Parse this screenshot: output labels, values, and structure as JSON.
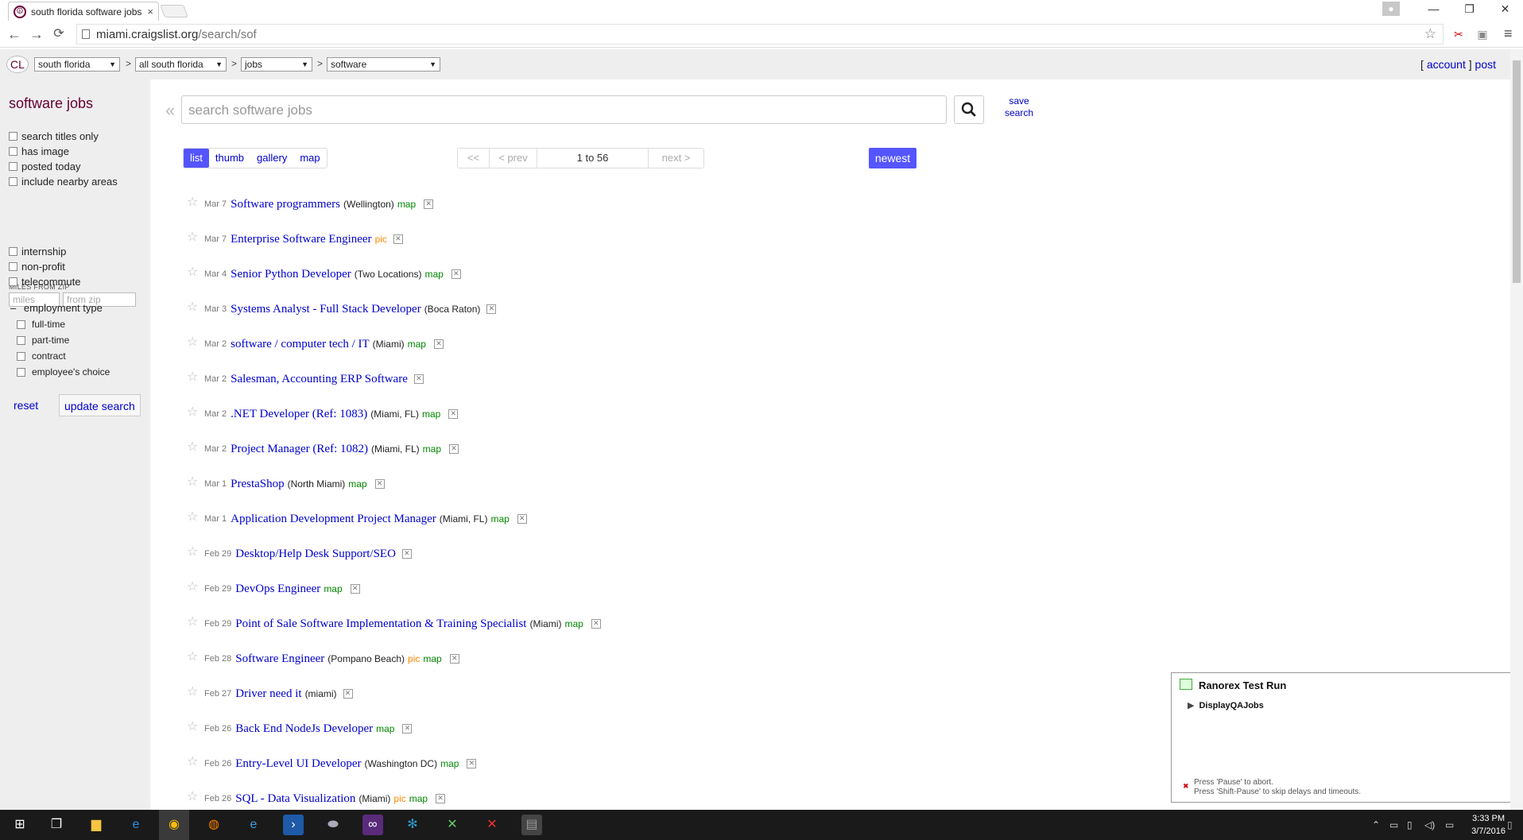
{
  "browser": {
    "tab_title": "south florida software jobs",
    "tab_close": "×",
    "url_host": "miami.craigslist.org",
    "url_path": "/search/sof",
    "back": "←",
    "forward": "→",
    "reload": "⟳",
    "bookmark_star": "☆",
    "menu": "≡"
  },
  "window_buttons": {
    "minimize": "—",
    "restore": "❐",
    "close": "✕"
  },
  "header": {
    "logo": "CL",
    "area": "south florida",
    "subarea": "all south florida",
    "category": "jobs",
    "subcategory": "software",
    "sep": ">",
    "account_open": "[",
    "account": "account",
    "account_close": "]",
    "post": "post"
  },
  "sidebar": {
    "title": "software jobs",
    "filters": [
      "search titles only",
      "has image",
      "posted today",
      "include nearby areas"
    ],
    "miles_label": "MILES FROM ZIP",
    "miles_placeholder": "miles",
    "zip_placeholder": "from zip",
    "flags": [
      "internship",
      "non-profit",
      "telecommute"
    ],
    "employment_toggle": "–",
    "employment_label": "employment type",
    "employment_types": [
      "full-time",
      "part-time",
      "contract",
      "employee's choice"
    ],
    "reset": "reset",
    "update": "update search"
  },
  "search": {
    "collapse": "«",
    "placeholder": "search software jobs",
    "save_line1": "save",
    "save_line2": "search"
  },
  "view_tabs": [
    "list",
    "thumb",
    "gallery",
    "map"
  ],
  "pager": {
    "first": "<<",
    "prev": "< prev",
    "range": "1 to 56",
    "next": "next >"
  },
  "sort": "newest",
  "listings": [
    {
      "date": "Mar 7",
      "title": "Software programmers",
      "hood": "(Wellington)",
      "pic": "",
      "map": "map"
    },
    {
      "date": "Mar 7",
      "title": "Enterprise Software Engineer",
      "hood": "",
      "pic": "pic",
      "map": ""
    },
    {
      "date": "Mar 4",
      "title": "Senior Python Developer",
      "hood": "(Two Locations)",
      "pic": "",
      "map": "map"
    },
    {
      "date": "Mar 3",
      "title": "Systems Analyst - Full Stack Developer",
      "hood": "(Boca Raton)",
      "pic": "",
      "map": ""
    },
    {
      "date": "Mar 2",
      "title": "software / computer tech / IT",
      "hood": "(Miami)",
      "pic": "",
      "map": "map"
    },
    {
      "date": "Mar 2",
      "title": "Salesman, Accounting ERP Software",
      "hood": "",
      "pic": "",
      "map": ""
    },
    {
      "date": "Mar 2",
      "title": ".NET Developer (Ref: 1083)",
      "hood": "(Miami, FL)",
      "pic": "",
      "map": "map"
    },
    {
      "date": "Mar 2",
      "title": "Project Manager (Ref: 1082)",
      "hood": "(Miami, FL)",
      "pic": "",
      "map": "map"
    },
    {
      "date": "Mar 1",
      "title": "PrestaShop",
      "hood": "(North Miami)",
      "pic": "",
      "map": "map"
    },
    {
      "date": "Mar 1",
      "title": "Application Development Project Manager",
      "hood": "(Miami, FL)",
      "pic": "",
      "map": "map"
    },
    {
      "date": "Feb 29",
      "title": "Desktop/Help Desk Support/SEO",
      "hood": "",
      "pic": "",
      "map": ""
    },
    {
      "date": "Feb 29",
      "title": "DevOps Engineer",
      "hood": "",
      "pic": "",
      "map": "map"
    },
    {
      "date": "Feb 29",
      "title": "Point of Sale Software Implementation & Training Specialist",
      "hood": "(Miami)",
      "pic": "",
      "map": "map"
    },
    {
      "date": "Feb 28",
      "title": "Software Engineer",
      "hood": "(Pompano Beach)",
      "pic": "pic",
      "map": "map"
    },
    {
      "date": "Feb 27",
      "title": "Driver need it",
      "hood": "(miami)",
      "pic": "",
      "map": ""
    },
    {
      "date": "Feb 26",
      "title": "Back End NodeJs Developer",
      "hood": "",
      "pic": "",
      "map": "map"
    },
    {
      "date": "Feb 26",
      "title": "Entry-Level UI Developer",
      "hood": "(Washington DC)",
      "pic": "",
      "map": "map"
    },
    {
      "date": "Feb 26",
      "title": "SQL - Data Visualization",
      "hood": "(Miami)",
      "pic": "pic",
      "map": "map"
    }
  ],
  "ranorex": {
    "title": "Ranorex Test Run",
    "item": "DisplayQAJobs",
    "note1": "Press 'Pause' to abort.",
    "note2": "Press 'Shift-Pause' to skip delays and timeouts."
  },
  "taskbar": {
    "time": "3:33 PM",
    "date": "3/7/2016"
  }
}
